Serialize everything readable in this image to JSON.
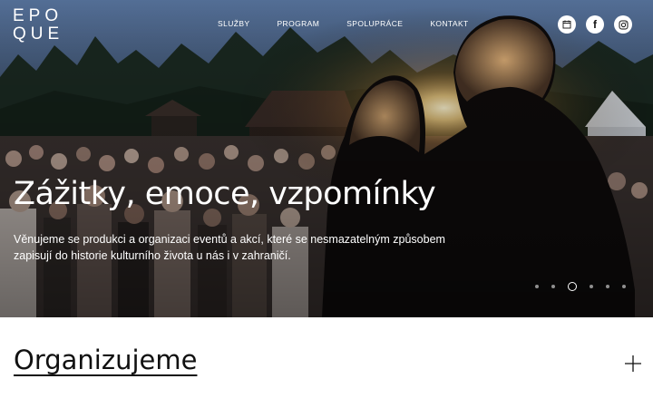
{
  "logo": {
    "line1": "EPO",
    "line2": "QUE"
  },
  "nav": {
    "items": [
      {
        "label": "SLUŽBY"
      },
      {
        "label": "PROGRAM"
      },
      {
        "label": "SPOLUPRÁCE"
      },
      {
        "label": "KONTAKT"
      }
    ]
  },
  "social": [
    {
      "icon": "calendar-icon"
    },
    {
      "icon": "facebook-icon",
      "glyph": "f"
    },
    {
      "icon": "instagram-icon"
    }
  ],
  "hero": {
    "title": "Zážitky, emoce, vzpomínky",
    "text": "Věnujeme se produkci a organizaci eventů a akcí, které se nesmazatelným způsobem zapisují do historie kulturního života u nás i v zahraničí."
  },
  "slider": {
    "count": 6,
    "active": 3
  },
  "section": {
    "title": "Organizujeme"
  }
}
